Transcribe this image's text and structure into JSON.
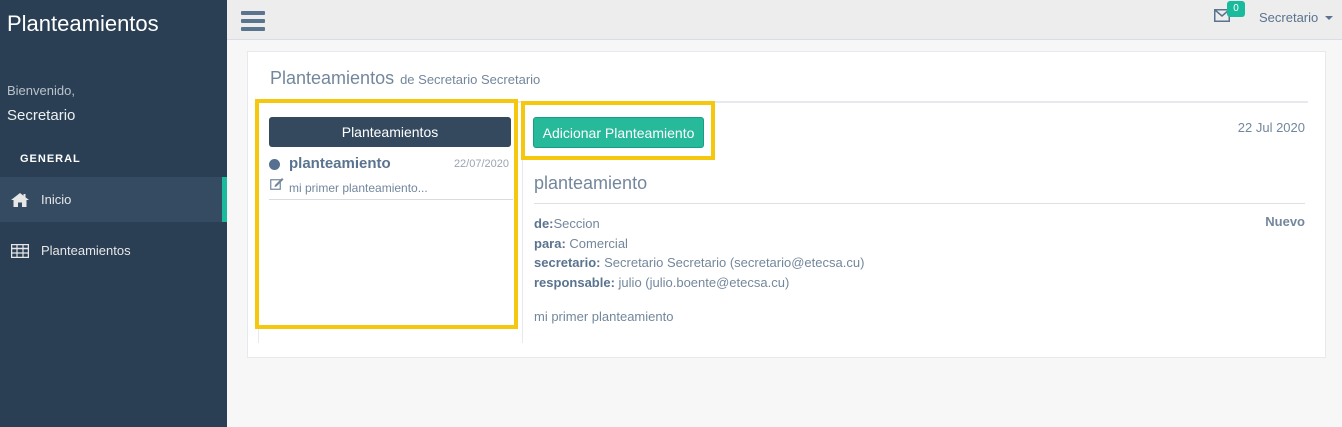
{
  "sidebar": {
    "brand": "Planteamientos",
    "welcome": "Bienvenido,",
    "username": "Secretario",
    "section_title": "GENERAL",
    "items": [
      {
        "label": "Inicio",
        "icon": "home-icon",
        "active": true
      },
      {
        "label": "Planteamientos",
        "icon": "table-icon",
        "active": false
      }
    ]
  },
  "topbar": {
    "menu_icon": "hamburger-icon",
    "mail_icon": "envelope-icon",
    "mail_count": "0",
    "user_label": "Secretario"
  },
  "panel": {
    "title": "Planteamientos",
    "subtitle": "de Secretario Secretario"
  },
  "list": {
    "header_label": "Planteamientos",
    "items": [
      {
        "title": "planteamiento",
        "date": "22/07/2020",
        "snippet": "mi primer planteamiento..."
      }
    ]
  },
  "detail": {
    "add_button_label": "Adicionar Planteamiento",
    "date": "22 Jul 2020",
    "title": "planteamiento",
    "status": "Nuevo",
    "de_label": "de:",
    "de_value": "Seccion",
    "para_label": "para:",
    "para_value": "Comercial",
    "secretario_label": "secretario:",
    "secretario_value": "Secretario Secretario (secretario@etecsa.cu)",
    "responsable_label": "responsable:",
    "responsable_value": "julio (julio.boente@etecsa.cu)",
    "body": "mi primer planteamiento"
  },
  "colors": {
    "sidebar_bg": "#2a3f54",
    "accent": "#1abb9c",
    "primary_button": "#26b99a",
    "list_header": "#34495e",
    "highlight": "#f5c80f"
  }
}
